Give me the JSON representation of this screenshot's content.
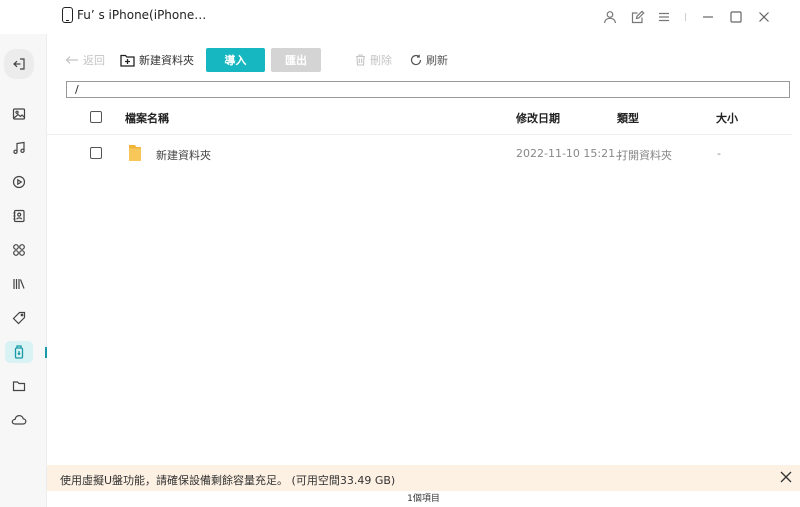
{
  "titlebar": {
    "device_name": "Fu’ s iPhone(iPhone…",
    "icons": [
      "account-icon",
      "feedback-icon",
      "menu-icon",
      "minimize-icon",
      "maximize-icon",
      "close-icon"
    ]
  },
  "sidebar": {
    "items": [
      {
        "name": "exit",
        "icon": "exit-icon"
      },
      {
        "name": "photos",
        "icon": "photo-icon"
      },
      {
        "name": "music",
        "icon": "music-icon"
      },
      {
        "name": "videos",
        "icon": "video-icon"
      },
      {
        "name": "contacts",
        "icon": "contacts-icon"
      },
      {
        "name": "apps",
        "icon": "apps-icon"
      },
      {
        "name": "books",
        "icon": "books-icon"
      },
      {
        "name": "ringtones",
        "icon": "tag-icon"
      },
      {
        "name": "udisk",
        "icon": "udisk-icon",
        "active": true
      },
      {
        "name": "files",
        "icon": "folder-icon"
      },
      {
        "name": "icloud",
        "icon": "cloud-icon"
      }
    ],
    "accent": "#1a9aa6"
  },
  "toolbar": {
    "back_label": "返回",
    "new_folder_label": "新建資料夾",
    "import_label": "導入",
    "export_label": "匯出",
    "delete_label": "刪除",
    "refresh_label": "刷新",
    "import_color": "#16b7c1"
  },
  "path": "/",
  "table": {
    "headers": {
      "name": "檔案名稱",
      "modified": "修改日期",
      "type": "類型",
      "size": "大小"
    },
    "rows": [
      {
        "name": "新建資料夾",
        "modified": "2022-11-10 15:21…",
        "type": "打開資料夾",
        "size": "-"
      }
    ]
  },
  "notice": {
    "text": "使用虛擬U盤功能，請確保設備剩餘容量充足。 (可用空間33.49 GB)"
  },
  "footer": {
    "count_label": "1個項目"
  }
}
